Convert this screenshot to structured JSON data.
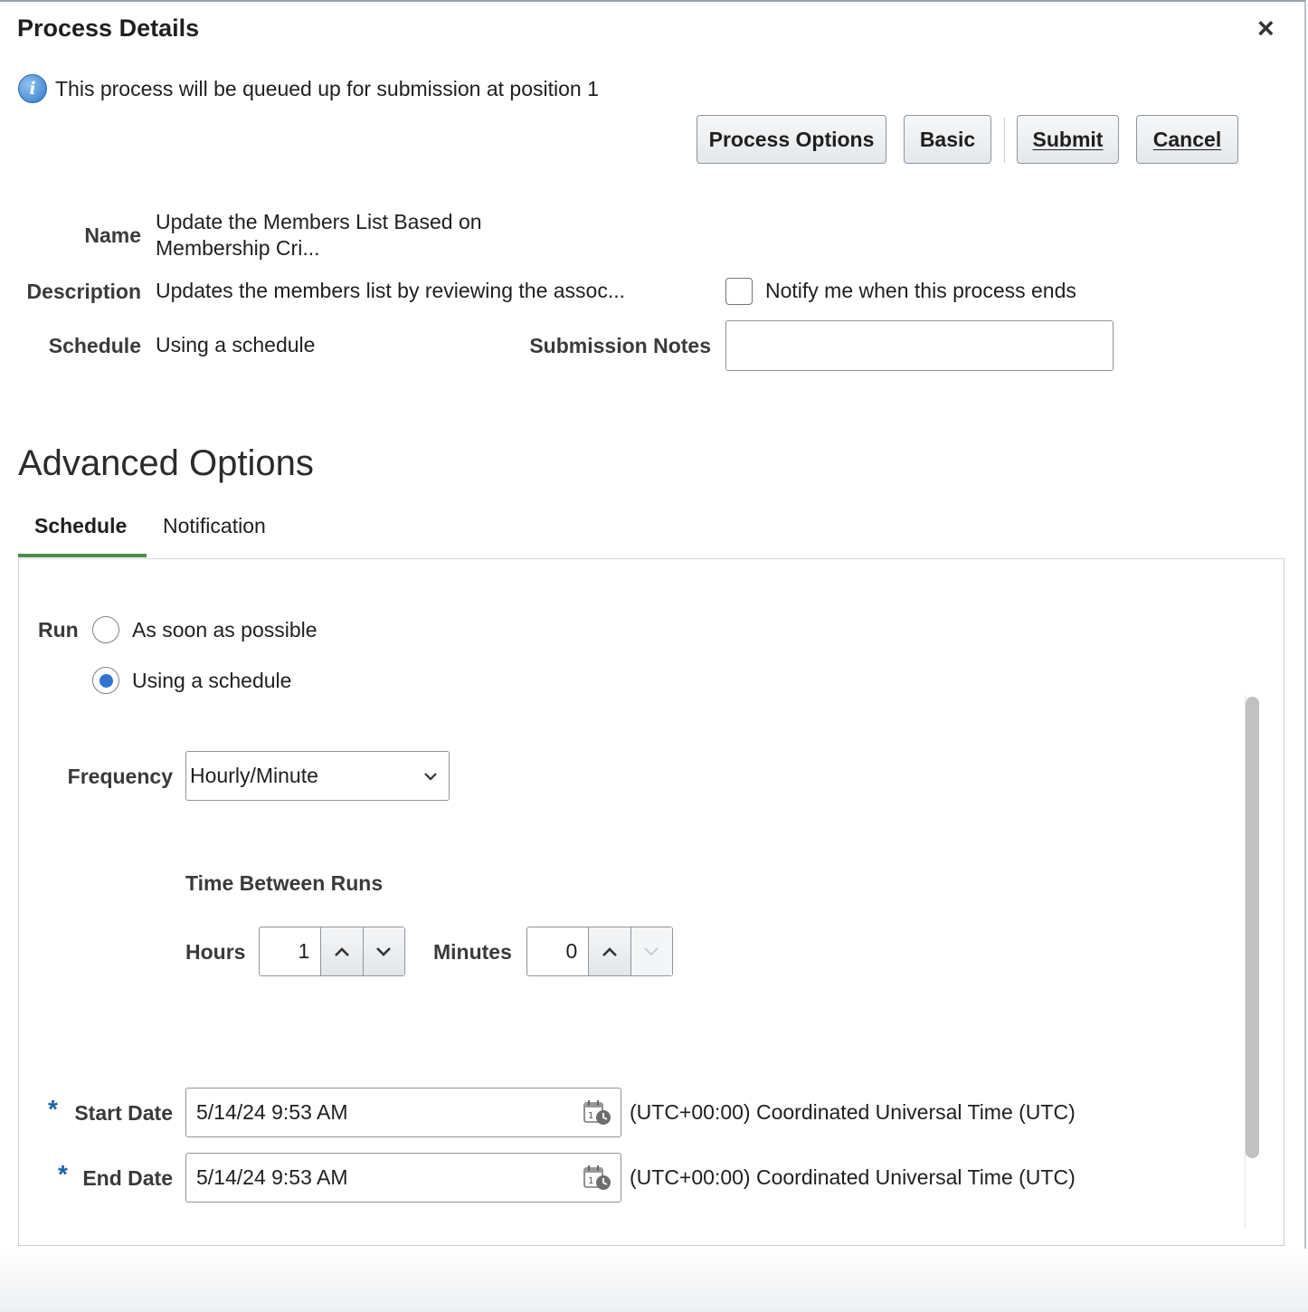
{
  "dialog": {
    "title": "Process Details",
    "close_glyph": "×",
    "info_message": "This process will be queued up for submission at position 1"
  },
  "toolbar": {
    "process_options_label": "Process Options",
    "basic_label": "Basic",
    "submit_label": "Submit",
    "cancel_label": "Cancel"
  },
  "details": {
    "name_label": "Name",
    "name_line1": "Update the Members List Based on",
    "name_line2": "Membership Cri...",
    "description_label": "Description",
    "description_value": "Updates the members list by reviewing the assoc...",
    "schedule_label": "Schedule",
    "schedule_value": "Using a schedule",
    "notify_label": "Notify me when this process ends",
    "notify_checked": false,
    "submission_notes_label": "Submission Notes",
    "submission_notes_value": ""
  },
  "advanced": {
    "heading": "Advanced Options",
    "tabs": [
      {
        "label": "Schedule",
        "active": true
      },
      {
        "label": "Notification",
        "active": false
      }
    ],
    "run_label": "Run",
    "run_options": [
      {
        "label": "As soon as possible",
        "selected": false
      },
      {
        "label": "Using a schedule",
        "selected": true
      }
    ],
    "frequency_label": "Frequency",
    "frequency_value": "Hourly/Minute",
    "time_between_runs_label": "Time Between Runs",
    "hours_label": "Hours",
    "hours_value": "1",
    "minutes_label": "Minutes",
    "minutes_value": "0",
    "required_marker": "*",
    "start_date_label": "Start Date",
    "start_date_value": "5/14/24 9:53 AM",
    "end_date_label": "End Date",
    "end_date_value": "5/14/24 9:53 AM",
    "timezone_text": "(UTC+00:00) Coordinated Universal Time (UTC)"
  },
  "icons": {
    "info": "info-icon",
    "close": "close-icon",
    "calendar": "calendar-icon",
    "chevron_down": "chevron-down-icon",
    "chevron_up": "chevron-up-icon"
  },
  "colors": {
    "accent_tab_underline": "#4f8a4c",
    "radio_selected": "#2f74d0",
    "required_asterisk": "#1f5fa8",
    "info_icon": "#2f79c8"
  }
}
